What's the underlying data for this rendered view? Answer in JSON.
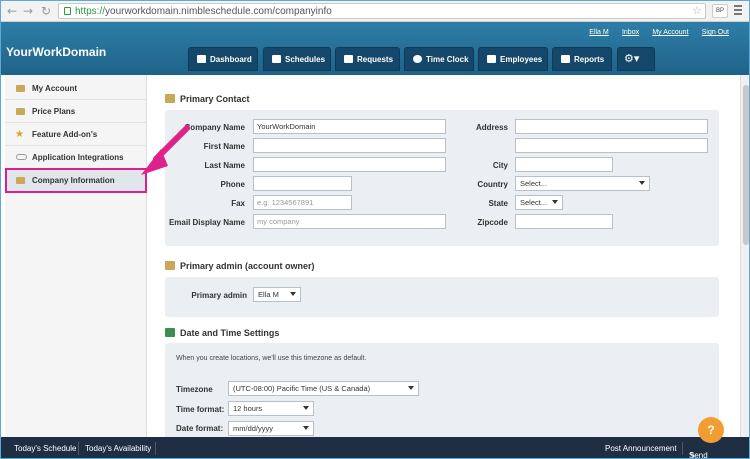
{
  "browser": {
    "url_scheme": "https://",
    "url_rest": "yourworkdomain.nimbleschedule.com/companyinfo",
    "profile_badge": "BP"
  },
  "header": {
    "brand": "YourWorkDomain",
    "user": "Ella M",
    "inbox": "Inbox",
    "my_account": "My Account",
    "sign_out": "Sign Out"
  },
  "nav": {
    "tabs": [
      "Dashboard",
      "Schedules",
      "Requests",
      "Time Clock",
      "Employees",
      "Reports"
    ]
  },
  "sidebar": {
    "items": [
      {
        "label": "My Account"
      },
      {
        "label": "Price Plans"
      },
      {
        "label": "Feature Add-on's"
      },
      {
        "label": "Application Integrations"
      },
      {
        "label": "Company Information"
      }
    ]
  },
  "primary_contact": {
    "title": "Primary Contact",
    "company_name_label": "Company Name",
    "company_name_value": "YourWorkDomain",
    "first_name_label": "First Name",
    "last_name_label": "Last Name",
    "phone_label": "Phone",
    "fax_label": "Fax",
    "fax_placeholder": "e.g. 1234567891",
    "email_label": "Email Display Name",
    "email_placeholder": "my company",
    "address_label": "Address",
    "city_label": "City",
    "country_label": "Country",
    "country_value": "Select...",
    "state_label": "State",
    "state_value": "Select...",
    "zipcode_label": "Zipcode"
  },
  "primary_admin": {
    "title": "Primary admin (account owner)",
    "label": "Primary admin",
    "value": "Ella M"
  },
  "datetime": {
    "title": "Date and Time Settings",
    "note": "When you create locations, we'll use this timezone as default.",
    "timezone_label": "Timezone",
    "timezone_value": "(UTC-08:00) Pacific Time (US & Canada)",
    "time_format_label": "Time format:",
    "time_format_value": "12 hours",
    "date_format_label": "Date format:",
    "date_format_value": "mm/dd/yyyy"
  },
  "footer": {
    "todays_schedule": "Today's Schedule",
    "todays_availability": "Today's Availability",
    "post_announcement": "Post Announcement",
    "send_message": "Send Message"
  },
  "help": {
    "label": "?"
  },
  "colors": {
    "accent": "#1f6289",
    "highlight": "#d9208b",
    "footer": "#1f2f43",
    "help": "#f39c32"
  }
}
